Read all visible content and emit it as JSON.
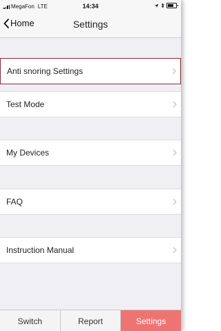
{
  "status_bar": {
    "carrier": "MegaFon",
    "network": "LTE",
    "time": "14:34"
  },
  "nav": {
    "back_label": "Home",
    "title": "Settings"
  },
  "settings": {
    "items": [
      {
        "label": "Anti snoring Settings",
        "highlighted": true
      },
      {
        "label": "Test Mode"
      },
      {
        "label": "My Devices"
      },
      {
        "label": "FAQ"
      },
      {
        "label": "Instruction Manual"
      }
    ]
  },
  "tabs": [
    {
      "label": "Switch"
    },
    {
      "label": "Report"
    },
    {
      "label": "Settings",
      "active": true
    }
  ],
  "colors": {
    "active_tab": "#ee7474",
    "highlight_border": "#8b2a3a",
    "background": "#efeff4"
  }
}
